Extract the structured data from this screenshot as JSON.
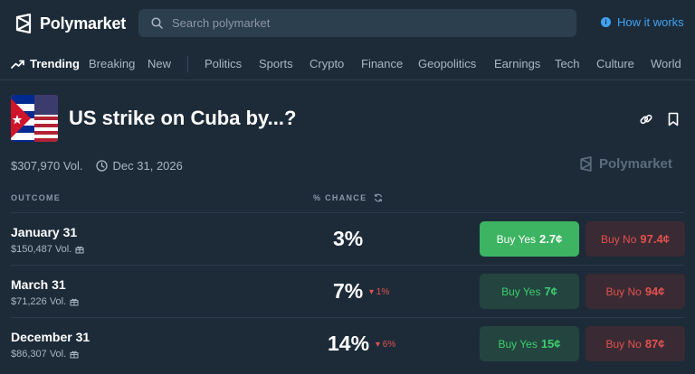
{
  "header": {
    "logo_text": "Polymarket",
    "search_placeholder": "Search polymarket",
    "how_it_works": "How it works",
    "colors": {
      "accent_blue": "#3fa3f2"
    }
  },
  "nav": {
    "trending": "Trending",
    "items": [
      "Breaking",
      "New",
      "Politics",
      "Sports",
      "Crypto",
      "Finance",
      "Geopolitics",
      "Earnings",
      "Tech",
      "Culture",
      "World"
    ]
  },
  "market": {
    "title": "US strike on Cuba by...?",
    "volume": "$307,970 Vol.",
    "end_date": "Dec 31, 2026",
    "watermark": "Polymarket"
  },
  "table": {
    "col_outcome": "OUTCOME",
    "col_chance": "% CHANCE",
    "rows": [
      {
        "name": "January 31",
        "volume": "$150,487 Vol.",
        "chance": "3%",
        "change": "",
        "yes_label": "Buy Yes",
        "yes_price": "2.7¢",
        "no_label": "Buy No",
        "no_price": "97.4¢"
      },
      {
        "name": "March 31",
        "volume": "$71,226 Vol.",
        "chance": "7%",
        "change": "▾ 1%",
        "yes_label": "Buy Yes",
        "yes_price": "7¢",
        "no_label": "Buy No",
        "no_price": "94¢"
      },
      {
        "name": "December 31",
        "volume": "$86,307 Vol.",
        "chance": "14%",
        "change": "▾ 6%",
        "yes_label": "Buy Yes",
        "yes_price": "15¢",
        "no_label": "Buy No",
        "no_price": "87¢"
      }
    ],
    "colors": {
      "yes": "#3cb461",
      "no": "#e2524f"
    }
  }
}
